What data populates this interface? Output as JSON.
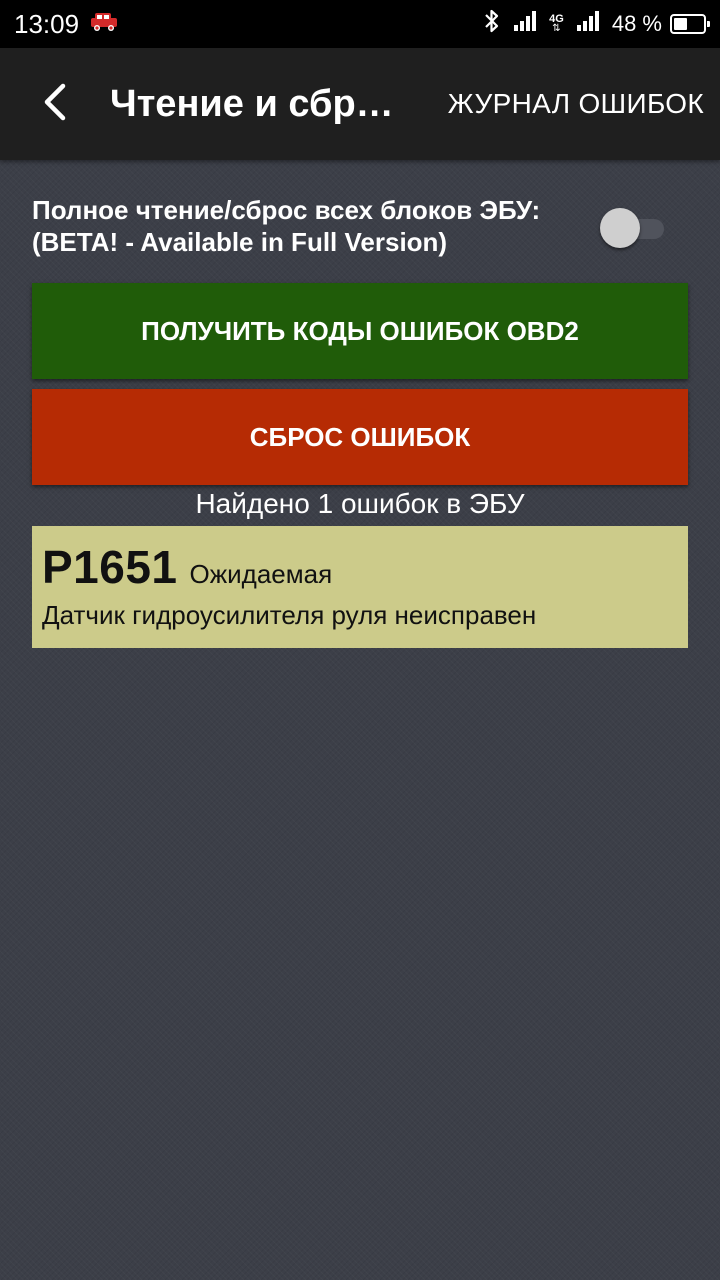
{
  "status_bar": {
    "time": "13:09",
    "notification_icon": "car-icon",
    "network_type": "4G",
    "battery_percent": "48 %",
    "battery_level": 0.48
  },
  "app_bar": {
    "back_icon": "chevron-left-icon",
    "title": "Чтение и сбр…",
    "journal_label": "ЖУРНАЛ ОШИБОК"
  },
  "full_read": {
    "label_line1": "Полное чтение/сброс всех блоков ЭБУ:",
    "label_line2": "(BETA! - Available in Full Version)",
    "enabled": false
  },
  "buttons": {
    "get_codes_label": "ПОЛУЧИТЬ КОДЫ ОШИБОК OBD2",
    "reset_label": "СБРОС ОШИБОК"
  },
  "results": {
    "found_text": "Найдено 1 ошибок в ЭБУ",
    "errors": [
      {
        "code": "P1651",
        "status": "Ожидаемая",
        "description": "Датчик гидроусилителя руля неисправен"
      }
    ]
  },
  "colors": {
    "get_button": "#205c09",
    "reset_button": "#b62b04",
    "error_card": "#cccb8a",
    "app_bar": "#1f1f1f"
  }
}
